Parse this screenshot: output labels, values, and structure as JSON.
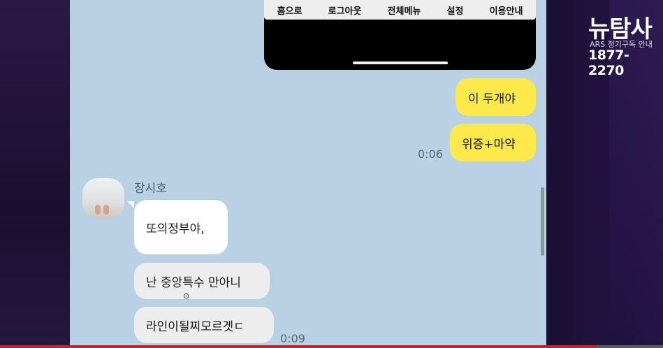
{
  "phone_nav": {
    "items": [
      "홈으로",
      "로그아웃",
      "전체메뉴",
      "설정",
      "이용안내"
    ]
  },
  "messages_me": {
    "msg1": "이 두개야",
    "msg2": "위증+마약",
    "time": "0:06"
  },
  "contact": {
    "name": "장시호"
  },
  "messages_them": {
    "msg1": "또의정부야,",
    "msg2": "난 중앙특수 만아니",
    "msg3": "라인이될찌모르겟ㄷ",
    "time": "0:09"
  },
  "logo": {
    "title": "뉴탐사",
    "subtitle": "ARS 정기구독 안내",
    "phone": "1877-2270"
  },
  "colors": {
    "chat_background": "#b9d1e4",
    "my_bubble": "#fde94a",
    "their_bubble": "#ffffff",
    "progress": "#e01a1a"
  },
  "video_progress": 0.9
}
